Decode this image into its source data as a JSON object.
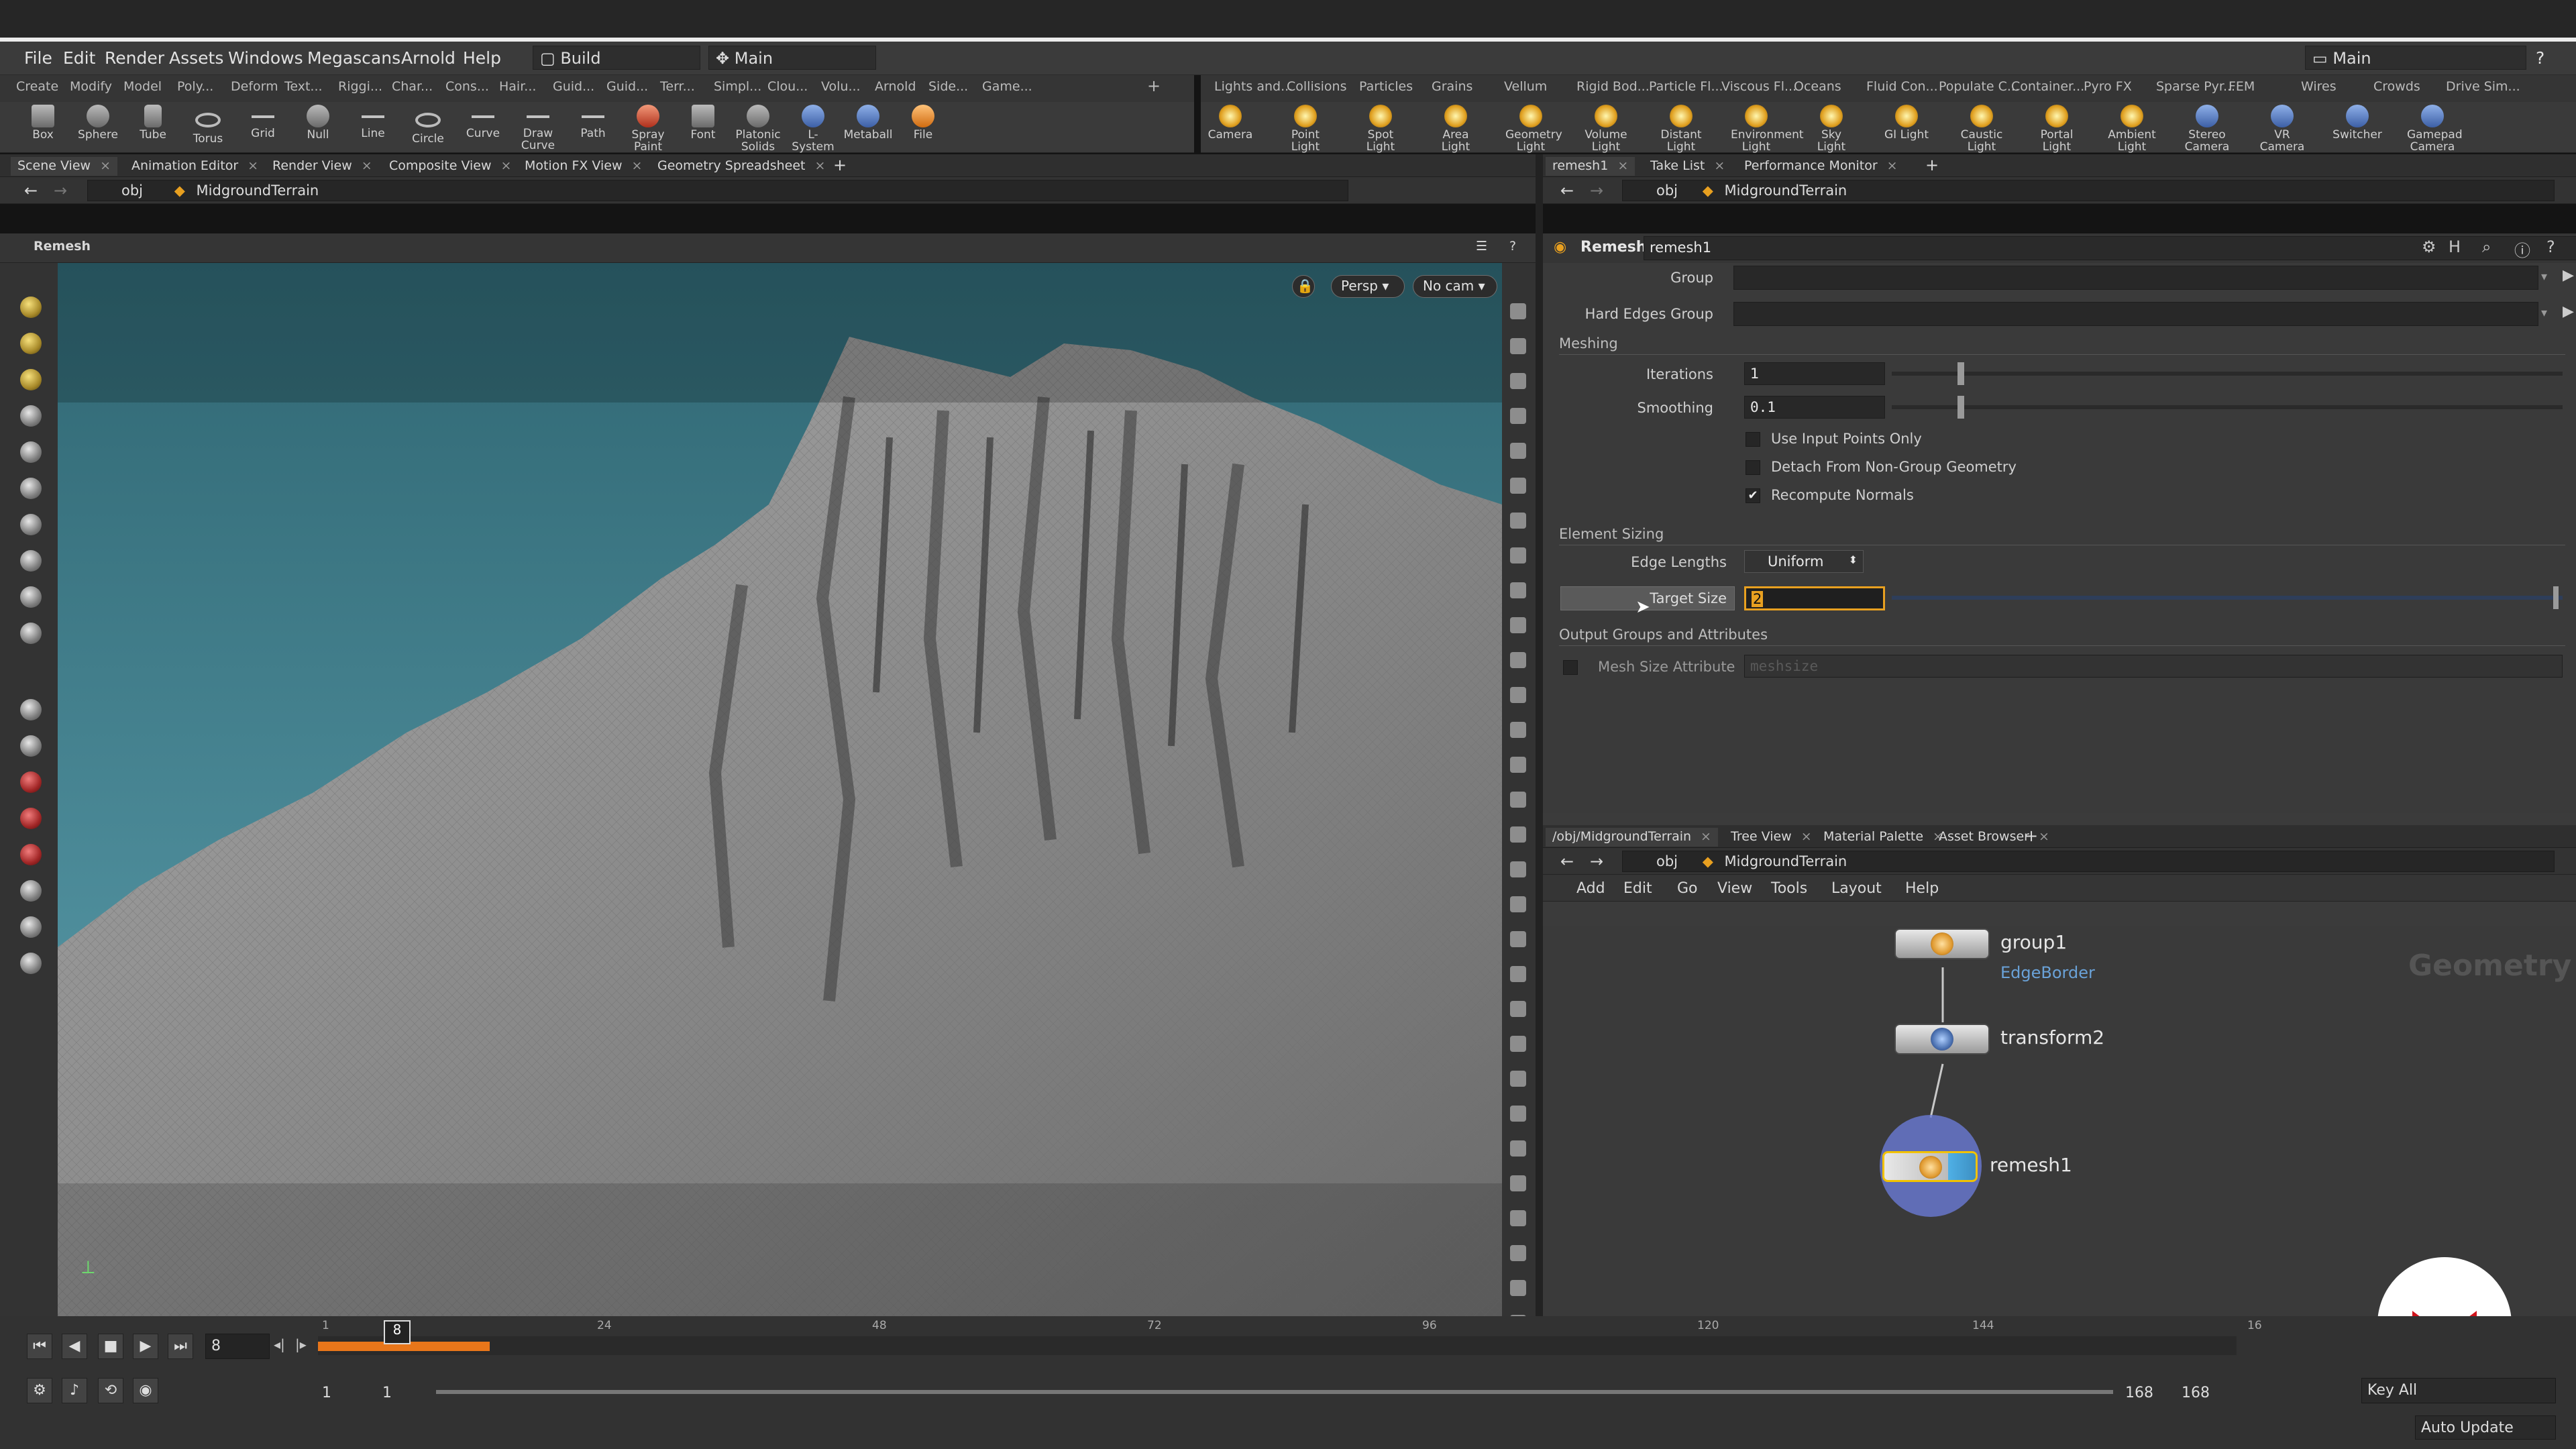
{
  "menu": [
    "File",
    "Edit",
    "Render",
    "Assets",
    "Windows",
    "Megascans",
    "Arnold",
    "Help"
  ],
  "desktop": {
    "label": "Build",
    "workspace": "Main",
    "right": "Main"
  },
  "shelf_tabs_left": [
    "Create",
    "Modify",
    "Model",
    "Poly...",
    "Deform",
    "Text...",
    "Riggi...",
    "Char...",
    "Cons...",
    "Hair...",
    "Guid...",
    "Guid...",
    "Terr...",
    "Simpl...",
    "Clou...",
    "Volu...",
    "Arnold",
    "Side...",
    "Game..."
  ],
  "shelf_tabs_right": [
    "Lights and...",
    "Collisions",
    "Particles",
    "Grains",
    "Vellum",
    "Rigid Bod...",
    "Particle Fl...",
    "Viscous Fl...",
    "Oceans",
    "Fluid Con...",
    "Populate C...",
    "Container...",
    "Pyro FX",
    "Sparse Pyr...",
    "FEM",
    "Wires",
    "Crowds",
    "Drive Sim..."
  ],
  "tools_left": [
    "Box",
    "Sphere",
    "Tube",
    "Torus",
    "Grid",
    "Null",
    "Line",
    "Circle",
    "Curve",
    "Draw Curve",
    "Path",
    "Spray Paint",
    "Font",
    "Platonic Solids",
    "L-System",
    "Metaball",
    "File"
  ],
  "tools_right": [
    "Camera",
    "Point Light",
    "Spot Light",
    "Area Light",
    "Geometry Light",
    "Volume Light",
    "Distant Light",
    "Environment Light",
    "Sky Light",
    "GI Light",
    "Caustic Light",
    "Portal Light",
    "Ambient Light",
    "Stereo Camera",
    "VR Camera",
    "Switcher",
    "Gamepad Camera"
  ],
  "left_tabs": [
    "Scene View",
    "Animation Editor",
    "Render View",
    "Composite View",
    "Motion FX View",
    "Geometry Spreadsheet"
  ],
  "right_tabs": [
    "remesh1",
    "Take List",
    "Performance Monitor"
  ],
  "net_tabs": [
    "/obj/MidgroundTerrain",
    "Tree View",
    "Material Palette",
    "Asset Browser"
  ],
  "path": {
    "obj": "obj",
    "node": "MidgroundTerrain"
  },
  "viewer": {
    "title": "Remesh",
    "persp": "Persp",
    "cam": "No cam"
  },
  "params": {
    "node_type": "Remesh",
    "node_name": "remesh1",
    "group_label": "Group",
    "hard_edges_label": "Hard Edges Group",
    "meshing": "Meshing",
    "iterations_label": "Iterations",
    "iterations": "1",
    "smoothing_label": "Smoothing",
    "smoothing": "0.1",
    "use_input_points": "Use Input Points Only",
    "detach": "Detach From Non-Group Geometry",
    "recompute": "Recompute Normals",
    "element_sizing": "Element Sizing",
    "edge_lengths_label": "Edge Lengths",
    "edge_lengths": "Uniform",
    "target_size_label": "Target Size",
    "target_size": "2",
    "output_groups": "Output Groups and Attributes",
    "mesh_size_label": "Mesh Size Attribute",
    "mesh_size": "meshsize"
  },
  "net_menu": [
    "Add",
    "Edit",
    "Go",
    "View",
    "Tools",
    "Layout",
    "Help"
  ],
  "network": {
    "watermark": "Geometry",
    "group1": "group1",
    "edgeborder": "EdgeBorder",
    "transform2": "transform2",
    "remesh1": "remesh1"
  },
  "timeline": {
    "frame": "8",
    "start": "1",
    "start2": "1",
    "end": "168",
    "end2": "168",
    "auto_update": "Auto Update",
    "keys": "Key All",
    "ticks": [
      "1",
      "24",
      "48",
      "72",
      "96",
      "120",
      "144",
      "16"
    ]
  },
  "colors": {
    "accent": "#e8a020",
    "viewport_sky": "#4e8a98",
    "logo": "#d0131b"
  }
}
